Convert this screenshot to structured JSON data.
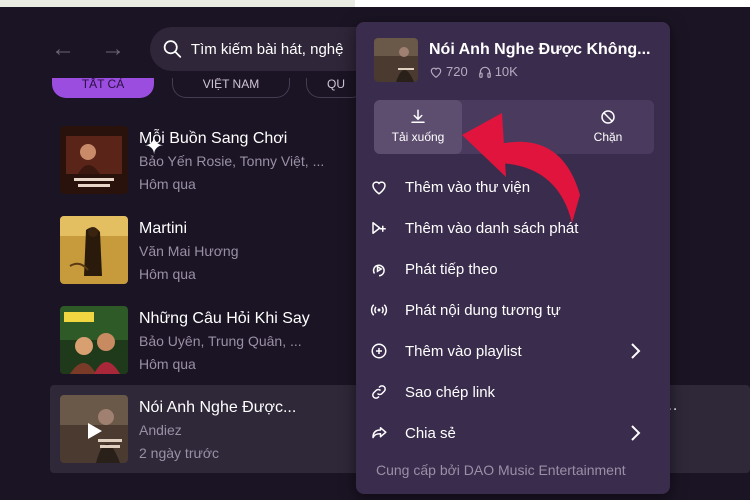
{
  "search": {
    "placeholder": "Tìm kiếm bài hát, nghệ"
  },
  "chips": [
    "TẤT CẢ",
    "VIỆT NAM",
    "QU"
  ],
  "songs": [
    {
      "title": "Mỗi Buồn Sang Chơi",
      "artist": "Bảo Yến Rosie, Tonny Việt, ...",
      "time": "Hôm qua"
    },
    {
      "title": "Martini",
      "artist": "Văn Mai Hương",
      "time": "Hôm qua"
    },
    {
      "title": "Những Câu Hỏi Khi Say",
      "artist": "Bảo Uyên, Trung Quân, ...",
      "time": "Hôm qua"
    },
    {
      "title": "Nói Anh Nghe Được...",
      "artist": "Andiez",
      "time": "2 ngày trước"
    }
  ],
  "row_dots": "...",
  "menu": {
    "title": "Nói Anh Nghe Được Không...",
    "likes": "720",
    "listens": "10K",
    "actions": {
      "download": "Tải xuống",
      "block": "Chặn"
    },
    "items": [
      {
        "label": "Thêm vào thư viện",
        "icon": "heart-icon"
      },
      {
        "label": "Thêm vào danh sách phát",
        "icon": "add-to-queue-icon"
      },
      {
        "label": "Phát tiếp theo",
        "icon": "play-next-icon"
      },
      {
        "label": "Phát nội dung tương tự",
        "icon": "broadcast-icon"
      },
      {
        "label": "Thêm vào playlist",
        "icon": "plus-circle-icon"
      },
      {
        "label": "Sao chép link",
        "icon": "link-icon"
      },
      {
        "label": "Chia sẻ",
        "icon": "share-icon"
      }
    ],
    "footer": "Cung cấp bởi DAO Music Entertainment"
  },
  "colors": {
    "background": "#1b1424",
    "menu": "#3a2c4d",
    "accent": "#9b4de0",
    "annotation_arrow": "#e0143c"
  }
}
